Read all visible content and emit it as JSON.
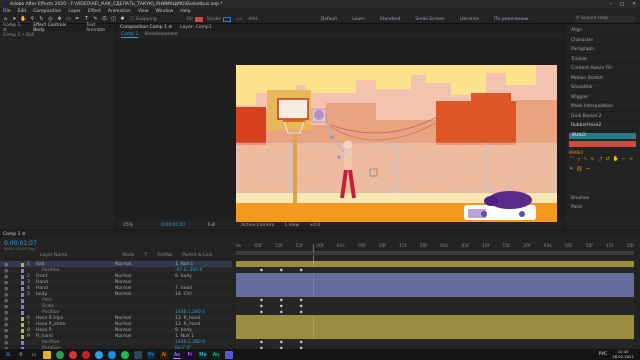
{
  "title": "Adobe After Effects 2020 - F:\\VIDEO\\AE\\_КАК_СДЕЛАТЬ_ТАКУЮ_АНИМАЦИЮ\\Basketbus.aep *",
  "menu": [
    "File",
    "Edit",
    "Composition",
    "Layer",
    "Effect",
    "Animation",
    "View",
    "Window",
    "Help"
  ],
  "toolbar": {
    "snapping": "Snapping",
    "fill_label": "Fill",
    "stroke_label": "Stroke",
    "stroke_width": "px",
    "add_label": "Add:",
    "workspaces": [
      "Default",
      "Learn",
      "Standard",
      "Small Screen",
      "Libraries",
      "По умолчанию"
    ],
    "search_placeholder": "Search Help"
  },
  "left_panel": {
    "tabs": [
      "Comp 1 ≡",
      "Effect Controls Body",
      "Text Animate"
    ],
    "crumb": "Comp 1 • Ball"
  },
  "comp_panel": {
    "tabs": [
      "Composition Comp 1 ≡",
      "Layer: Comp1"
    ],
    "subtabs": [
      "Comp 1",
      "Shooterperson"
    ],
    "zoom": "25%",
    "timecode": "0:00:01:07",
    "quality": "Full",
    "camera": "Active Camera",
    "views": "1 View",
    "plus": "+0.0"
  },
  "right_panel": {
    "items": [
      "Align",
      "Character",
      "Paragraph",
      "Tracker",
      "Content-Aware Fill",
      "Motion Sketch",
      "Smoother",
      "Wiggler",
      "Mask Interpolation",
      "Duik Bassel.2",
      "RubberHose2"
    ],
    "rubberhose": {
      "build_label": "BUILD",
      "colors": [
        "#d14a3b",
        "#2c7a8a"
      ],
      "plus_label": "MAKE4"
    },
    "bottom_items": [
      "Brushes",
      "Paint"
    ]
  },
  "timeline": {
    "tab": "Comp 1 ≡",
    "timecode": "0:00:01:07",
    "fps": "00031 (25.00 fps)",
    "col_headers": [
      "Layer Name",
      "Mode",
      "T",
      "TrkMat",
      "Parent & Link"
    ],
    "layers": [
      {
        "num": "1",
        "name": "Ball",
        "mode": "Normal",
        "parent": "1. Ball 1",
        "color": "#c2b24c"
      },
      {
        "num": "",
        "name": "Position",
        "mode": "",
        "parent": "-97.0, 300.0",
        "color": "#7a85c7"
      },
      {
        "num": "2",
        "name": "Front",
        "mode": "Normal",
        "parent": "8. body",
        "color": "#7a85c7"
      },
      {
        "num": "3",
        "name": "Hand",
        "mode": "Normal",
        "parent": "",
        "color": "#7a85c7"
      },
      {
        "num": "4",
        "name": "Hand",
        "mode": "Normal",
        "parent": "7. head",
        "color": "#7a85c7"
      },
      {
        "num": "5",
        "name": "body",
        "mode": "Normal",
        "parent": "14. Ctrl",
        "color": "#7a85c7"
      },
      {
        "num": "",
        "name": "Path",
        "mode": "",
        "parent": "",
        "color": "#7a85c7"
      },
      {
        "num": "",
        "name": "Scale",
        "mode": "",
        "parent": "",
        "color": "#7a85c7"
      },
      {
        "num": "",
        "name": "Position",
        "mode": "",
        "parent": "1440.1,280.0",
        "color": "#7a85c7"
      },
      {
        "num": "6",
        "name": "Hose R Hips",
        "mode": "Normal",
        "parent": "13. R_hand",
        "color": "#c2b24c"
      },
      {
        "num": "7",
        "name": "Hose R_state",
        "mode": "Normal",
        "parent": "13. R_hand",
        "color": "#c2b24c"
      },
      {
        "num": "8",
        "name": "Hose R",
        "mode": "Normal",
        "parent": "9. body",
        "color": "#c2b24c"
      },
      {
        "num": "9",
        "name": "R_hand",
        "mode": "Normal",
        "parent": "1. Null 1",
        "color": "#c2b24c"
      },
      {
        "num": "",
        "name": "Position",
        "mode": "",
        "parent": "1440.1,280.0",
        "color": "#7a85c7"
      },
      {
        "num": "",
        "name": "Rotation",
        "mode": "",
        "parent": "0x-7.0°",
        "color": "#7a85c7"
      }
    ],
    "ruler": [
      "0s",
      "05f",
      "10f",
      "15f",
      "20f",
      "01s",
      "05f",
      "10f",
      "15f",
      "20f",
      "02s",
      "05f",
      "10f",
      "15f",
      "20f",
      "03s",
      "05f",
      "10f",
      "15f",
      "20f"
    ]
  },
  "taskbar": {
    "time": "10:45",
    "date": "28.02.2021",
    "lang": "РУС"
  }
}
